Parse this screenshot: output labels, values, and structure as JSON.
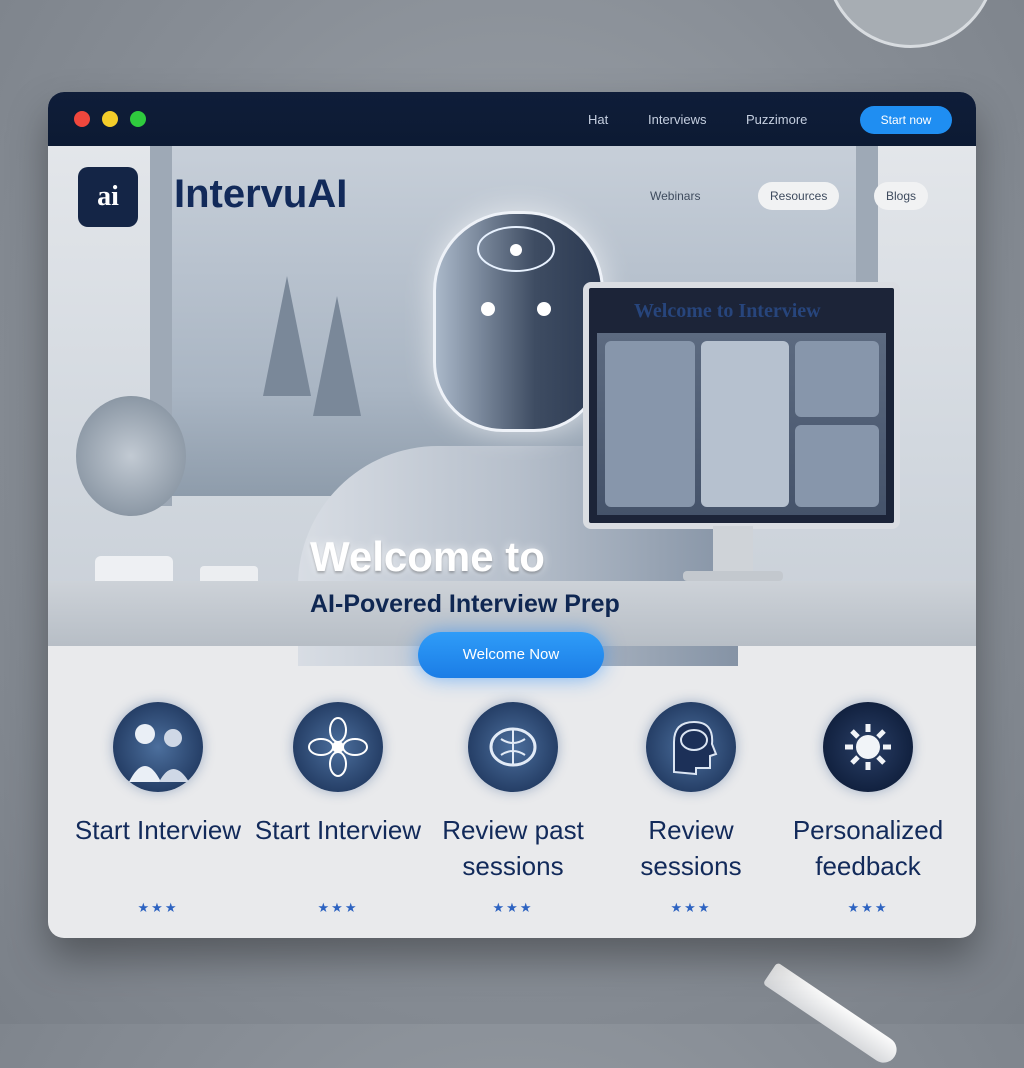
{
  "window": {
    "title_links": [
      "Hat",
      "Interviews",
      "Puzzimore"
    ],
    "title_cta": "Start now"
  },
  "hero": {
    "brand": "IntervuAI",
    "logo_text": "ai",
    "nav": [
      "Webinars",
      "Resources",
      "Blogs"
    ],
    "monitor_title": "Welcome to Interview",
    "title": "Welcome to",
    "subtitle": "AI-Povered Interview Prep",
    "cta": "Welcome Now"
  },
  "features": [
    {
      "label": "Start Interview",
      "icon": "people-icon",
      "stars": "★★★"
    },
    {
      "label": "Start Interview",
      "icon": "network-icon",
      "stars": "★★★"
    },
    {
      "label": "Review past sessions",
      "icon": "brain-icon",
      "stars": "★★★"
    },
    {
      "label": "Review sessions",
      "icon": "head-brain-icon",
      "stars": "★★★"
    },
    {
      "label": "Personalized feedback",
      "icon": "gear-icon",
      "stars": "★★★"
    }
  ],
  "colors": {
    "accent": "#1f8ef2",
    "brand": "#122a5a",
    "titlebar": "#0f1d39"
  }
}
